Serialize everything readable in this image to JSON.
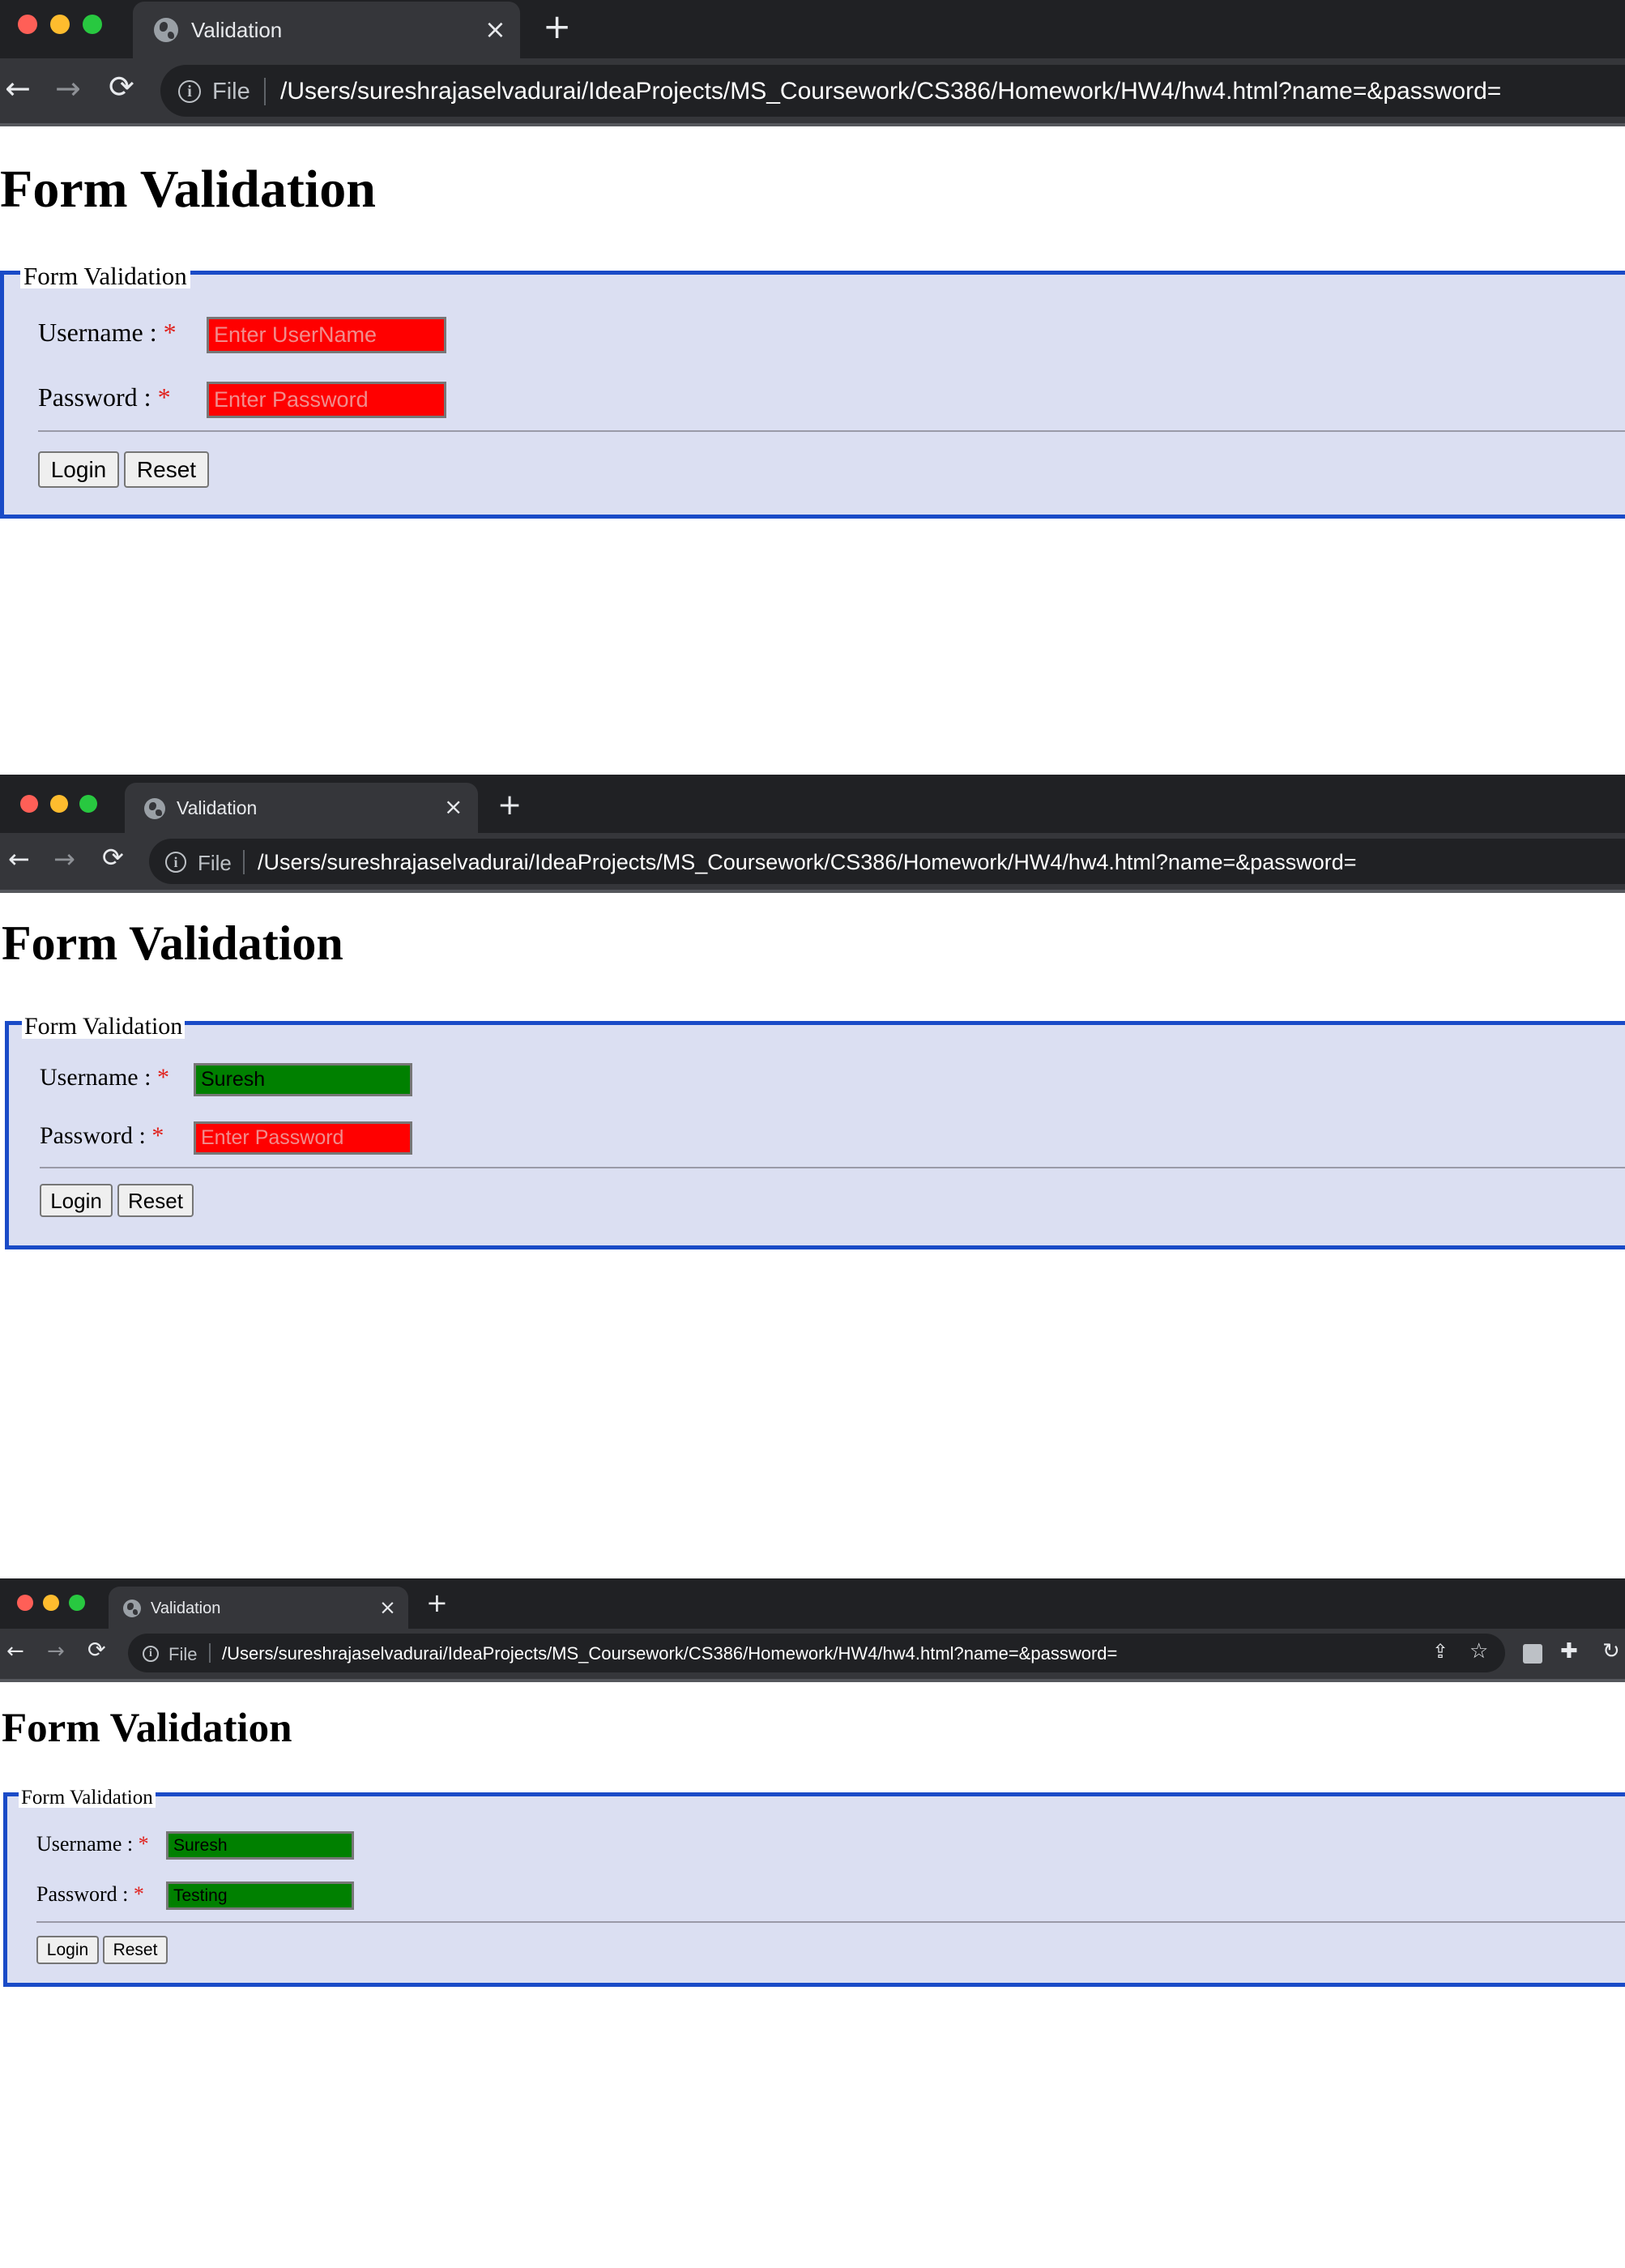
{
  "browser": {
    "tab_title": "Validation",
    "new_tab_label": "+",
    "close_label": "×",
    "back_label": "←",
    "forward_label": "→",
    "reload_label": "⟳",
    "info_label": "i",
    "scheme_label": "File",
    "url": "/Users/sureshrajaselvadurai/IdeaProjects/MS_Coursework/CS386/Homework/HW4/hw4.html?name=&password=",
    "traffic_light_colors": {
      "close": "#ff5f57",
      "minimize": "#febc2e",
      "maximize": "#28c840"
    },
    "toolbar_icons": [
      "share-icon",
      "star-icon",
      "extension-square-icon",
      "puzzle-icon",
      "sync-icon"
    ]
  },
  "form": {
    "page_heading": "Form Validation",
    "legend": "Form Validation",
    "username_label": "Username : ",
    "password_label": "Password : ",
    "required_mark": "*",
    "username_placeholder": "Enter UserName",
    "password_placeholder": "Enter Password",
    "login_label": "Login",
    "reset_label": "Reset"
  },
  "colors": {
    "invalid_field": "#ff0000",
    "valid_field": "#008000",
    "fieldset_border": "#1a4bc7",
    "fieldset_background": "#dbdff2"
  },
  "states": [
    {
      "username_value": "",
      "password_value": "",
      "username_status": "invalid",
      "password_status": "invalid"
    },
    {
      "username_value": "Suresh",
      "password_value": "",
      "username_status": "valid",
      "password_status": "invalid"
    },
    {
      "username_value": "Suresh",
      "password_value": "Testing",
      "username_status": "valid",
      "password_status": "valid"
    }
  ]
}
